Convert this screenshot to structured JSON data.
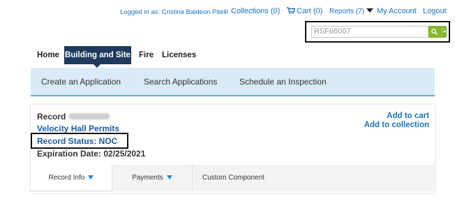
{
  "header": {
    "logged_in_text": "Logged in as: Cristina Baldeon Pitelli",
    "collections": "Collections (0)",
    "cart": "Cart (0)",
    "reports": "Reports (7)",
    "my_account": "My Account",
    "logout": "Logout"
  },
  "search": {
    "value": "RSF06007"
  },
  "main_nav": [
    "Home",
    "Building and Site",
    "Fire",
    "Licenses"
  ],
  "sub_nav": [
    "Create an Application",
    "Search Applications",
    "Schedule an Inspection"
  ],
  "record": {
    "label": "Record",
    "permit_type": "Velocity Hall Permits",
    "status": "Record Status: NOC",
    "expiration": "Expiration Date: 02/25/2021",
    "add_to_cart": "Add to cart",
    "add_to_collection": "Add to collection"
  },
  "record_tabs": [
    "Record Info",
    "Payments",
    "Custom Component"
  ],
  "colors": {
    "link": "#1a73c4",
    "nav_active": "#1e3a5c",
    "subnav_bg": "#d9ebf7",
    "search_button": "#86b82e",
    "record_text": "#1a5aa8"
  }
}
